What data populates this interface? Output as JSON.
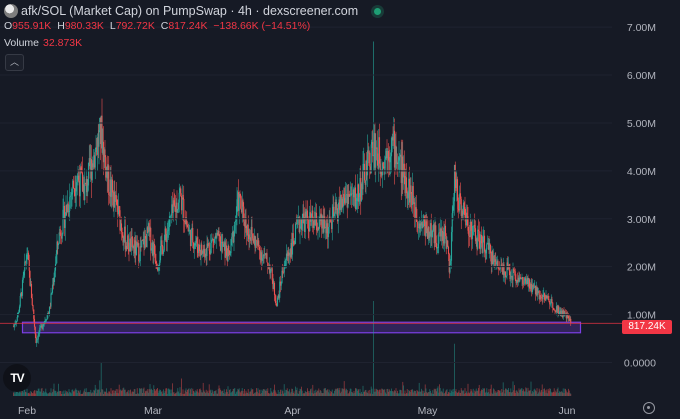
{
  "header": {
    "title": "afk/SOL (Market Cap) on PumpSwap · 4h · dexscreener.com",
    "ohlc": [
      {
        "k": "O",
        "v": "955.91K"
      },
      {
        "k": "H",
        "v": "980.33K"
      },
      {
        "k": "L",
        "v": "792.72K"
      },
      {
        "k": "C",
        "v": "817.24K"
      }
    ],
    "change": "−138.66K (−14.51%)",
    "volume_label": "Volume",
    "volume_value": "32.873K"
  },
  "logo": "TV",
  "colors": {
    "up": "#26a69a",
    "down": "#ef5350",
    "zone": "#7b3fe4",
    "last": "#f23645"
  },
  "chart_data": {
    "type": "candlestick",
    "title": "afk/SOL (Market Cap) on PumpSwap · 4h · dexscreener.com",
    "y_ticks": [
      {
        "v": 0,
        "label": "0.0000"
      },
      {
        "v": 1,
        "label": "1.00M"
      },
      {
        "v": 2,
        "label": "2.00M"
      },
      {
        "v": 3,
        "label": "3.00M"
      },
      {
        "v": 4,
        "label": "4.00M"
      },
      {
        "v": 5,
        "label": "5.00M"
      },
      {
        "v": 6,
        "label": "6.00M"
      },
      {
        "v": 7,
        "label": "7.00M"
      }
    ],
    "ylim": [
      -0.7,
      7.4
    ],
    "y_unit": "M",
    "x_ticks": [
      {
        "day": 3,
        "label": "Feb"
      },
      {
        "day": 31,
        "label": "Mar"
      },
      {
        "day": 62,
        "label": "Apr"
      },
      {
        "day": 92,
        "label": "May"
      },
      {
        "day": 123,
        "label": "Jun"
      }
    ],
    "xlim": [
      -3,
      133
    ],
    "last_value": 0.817,
    "last_label": "817.24K",
    "zone": {
      "start_day": 2,
      "end_day": 126,
      "low": 0.62,
      "high": 0.84
    },
    "anchors": [
      [
        0,
        0.75
      ],
      [
        1,
        1.0
      ],
      [
        2,
        1.6
      ],
      [
        3,
        2.3
      ],
      [
        4,
        1.4
      ],
      [
        5,
        0.45
      ],
      [
        6,
        0.7
      ],
      [
        8,
        1.1
      ],
      [
        10,
        2.6
      ],
      [
        12,
        3.3
      ],
      [
        14,
        3.9
      ],
      [
        16,
        3.6
      ],
      [
        18,
        4.4
      ],
      [
        19.5,
        4.8
      ],
      [
        21,
        3.8
      ],
      [
        23,
        3.2
      ],
      [
        25,
        2.5
      ],
      [
        28,
        2.3
      ],
      [
        30,
        2.7
      ],
      [
        32,
        2.1
      ],
      [
        35,
        3.0
      ],
      [
        37,
        3.5
      ],
      [
        39,
        2.7
      ],
      [
        42,
        2.3
      ],
      [
        45,
        2.6
      ],
      [
        48,
        2.2
      ],
      [
        50,
        3.4
      ],
      [
        52,
        2.8
      ],
      [
        55,
        2.3
      ],
      [
        57,
        2.0
      ],
      [
        58.5,
        1.2
      ],
      [
        60,
        2.0
      ],
      [
        62,
        2.5
      ],
      [
        64,
        3.0
      ],
      [
        67,
        2.9
      ],
      [
        70,
        2.8
      ],
      [
        72,
        3.2
      ],
      [
        74,
        3.5
      ],
      [
        76,
        3.4
      ],
      [
        78,
        3.9
      ],
      [
        80,
        4.5
      ],
      [
        82,
        4.2
      ],
      [
        84,
        4.6
      ],
      [
        86,
        4.1
      ],
      [
        88,
        3.6
      ],
      [
        90,
        3.0
      ],
      [
        92,
        2.8
      ],
      [
        94,
        2.6
      ],
      [
        96,
        2.7
      ],
      [
        97,
        1.9
      ],
      [
        98,
        3.9
      ],
      [
        99,
        3.4
      ],
      [
        101,
        2.9
      ],
      [
        103,
        2.6
      ],
      [
        105,
        2.4
      ],
      [
        107,
        2.1
      ],
      [
        110,
        1.9
      ],
      [
        113,
        1.7
      ],
      [
        116,
        1.5
      ],
      [
        119,
        1.3
      ],
      [
        121,
        1.1
      ],
      [
        123,
        0.95
      ],
      [
        124,
        0.82
      ]
    ],
    "spikes": [
      {
        "day": 3,
        "high": 2.4
      },
      {
        "day": 19.5,
        "high": 4.9
      },
      {
        "day": 80,
        "high": 6.7
      },
      {
        "day": 98,
        "high": 4.05
      }
    ],
    "volume_spikes": [
      {
        "day": 80,
        "value": 1.0
      },
      {
        "day": 98,
        "value": 0.55
      },
      {
        "day": 19.5,
        "value": 0.35
      }
    ],
    "volume_max_label": "32.873K"
  }
}
